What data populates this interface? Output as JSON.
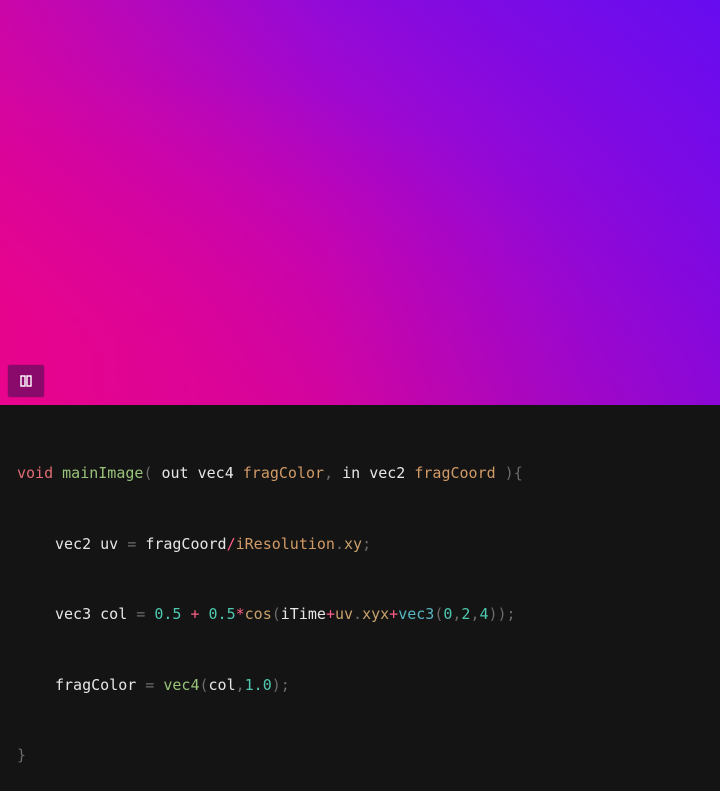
{
  "viewport": {
    "pause_button_label": "Pause",
    "colors": {
      "left": "#e8068a",
      "center": "#a006c8",
      "right": "#6a0ff0",
      "button_bg": "#8a0a6c"
    }
  },
  "code": {
    "lines": [
      [
        {
          "t": "void",
          "c": "kw"
        },
        {
          "t": " ",
          "c": "id"
        },
        {
          "t": "mainImage",
          "c": "fn"
        },
        {
          "t": "( ",
          "c": "punct"
        },
        {
          "t": "out vec4",
          "c": "id"
        },
        {
          "t": " ",
          "c": "id"
        },
        {
          "t": "fragColor",
          "c": "param"
        },
        {
          "t": ", ",
          "c": "punct"
        },
        {
          "t": "in vec2",
          "c": "id"
        },
        {
          "t": " ",
          "c": "id"
        },
        {
          "t": "fragCoord",
          "c": "param"
        },
        {
          "t": " ){",
          "c": "punct"
        }
      ],
      [
        {
          "t": "vec2 uv",
          "c": "id"
        },
        {
          "t": " = ",
          "c": "punct"
        },
        {
          "t": "fragCoord",
          "c": "id"
        },
        {
          "t": "/",
          "c": "op"
        },
        {
          "t": "iResolution",
          "c": "param"
        },
        {
          "t": ".",
          "c": "punct"
        },
        {
          "t": "xy",
          "c": "mem"
        },
        {
          "t": ";",
          "c": "punct"
        }
      ],
      [
        {
          "t": "vec3 col",
          "c": "id"
        },
        {
          "t": " = ",
          "c": "punct"
        },
        {
          "t": "0.5",
          "c": "num"
        },
        {
          "t": " + ",
          "c": "op"
        },
        {
          "t": "0.5",
          "c": "num"
        },
        {
          "t": "*",
          "c": "op"
        },
        {
          "t": "cos",
          "c": "mem"
        },
        {
          "t": "(",
          "c": "punct"
        },
        {
          "t": "iTime",
          "c": "id"
        },
        {
          "t": "+",
          "c": "op"
        },
        {
          "t": "uv",
          "c": "mem"
        },
        {
          "t": ".",
          "c": "punct"
        },
        {
          "t": "xyx",
          "c": "mem"
        },
        {
          "t": "+",
          "c": "op"
        },
        {
          "t": "vec3",
          "c": "call"
        },
        {
          "t": "(",
          "c": "punct"
        },
        {
          "t": "0",
          "c": "num"
        },
        {
          "t": ",",
          "c": "punct"
        },
        {
          "t": "2",
          "c": "num"
        },
        {
          "t": ",",
          "c": "punct"
        },
        {
          "t": "4",
          "c": "num"
        },
        {
          "t": "));",
          "c": "punct"
        }
      ],
      [
        {
          "t": "fragColor",
          "c": "id"
        },
        {
          "t": " = ",
          "c": "punct"
        },
        {
          "t": "vec4",
          "c": "fn"
        },
        {
          "t": "(",
          "c": "punct"
        },
        {
          "t": "col",
          "c": "id"
        },
        {
          "t": ",",
          "c": "punct"
        },
        {
          "t": "1.0",
          "c": "num"
        },
        {
          "t": ");",
          "c": "punct"
        }
      ],
      [
        {
          "t": "}",
          "c": "punct"
        }
      ]
    ]
  }
}
